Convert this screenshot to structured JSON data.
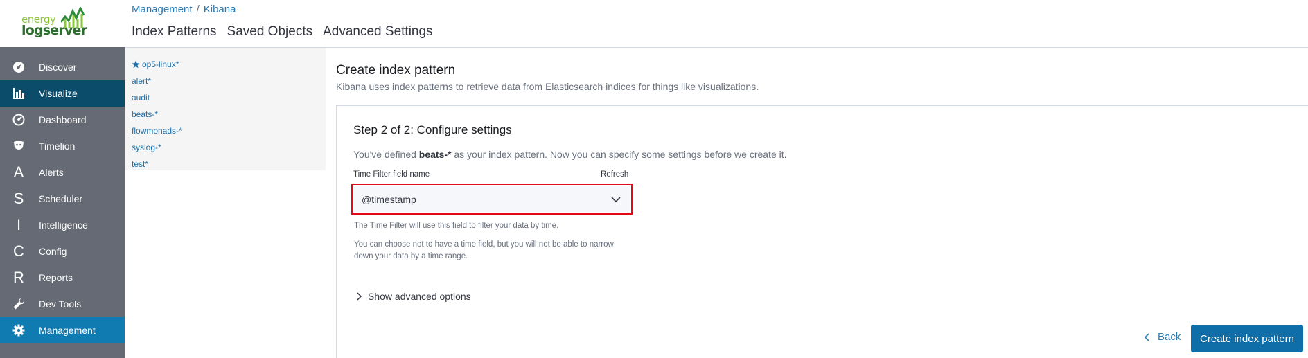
{
  "logo": {
    "line1": "energy",
    "line2": "logserver"
  },
  "sidebar": {
    "items": [
      {
        "label": "Discover",
        "icon": "compass-icon",
        "state": "normal"
      },
      {
        "label": "Visualize",
        "icon": "bar-chart-icon",
        "state": "active"
      },
      {
        "label": "Dashboard",
        "icon": "dashboard-icon",
        "state": "normal"
      },
      {
        "label": "Timelion",
        "icon": "timelion-icon",
        "state": "normal"
      },
      {
        "label": "Alerts",
        "icon": "A",
        "state": "normal"
      },
      {
        "label": "Scheduler",
        "icon": "S",
        "state": "normal"
      },
      {
        "label": "Intelligence",
        "icon": "I",
        "state": "normal"
      },
      {
        "label": "Config",
        "icon": "C",
        "state": "normal"
      },
      {
        "label": "Reports",
        "icon": "R",
        "state": "normal"
      },
      {
        "label": "Dev Tools",
        "icon": "wrench-icon",
        "state": "normal"
      },
      {
        "label": "Management",
        "icon": "gear-icon",
        "state": "selected"
      }
    ]
  },
  "breadcrumb": {
    "root": "Management",
    "sep": "/",
    "current": "Kibana"
  },
  "tabs": [
    "Index Patterns",
    "Saved Objects",
    "Advanced Settings"
  ],
  "pattern_list": [
    {
      "label": "op5-linux*",
      "default": true
    },
    {
      "label": "alert*",
      "default": false
    },
    {
      "label": "audit",
      "default": false
    },
    {
      "label": "beats-*",
      "default": false
    },
    {
      "label": "flowmonads-*",
      "default": false
    },
    {
      "label": "syslog-*",
      "default": false
    },
    {
      "label": "test*",
      "default": false
    }
  ],
  "main": {
    "title": "Create index pattern",
    "subtitle": "Kibana uses index patterns to retrieve data from Elasticsearch indices for things like visualizations.",
    "step_title": "Step 2 of 2: Configure settings",
    "desc_prefix": "You've defined ",
    "desc_pattern": "beats-*",
    "desc_suffix": " as your index pattern. Now you can specify some settings before we create it.",
    "field_label": "Time Filter field name",
    "refresh": "Refresh",
    "time_field_value": "@timestamp",
    "help1": "The Time Filter will use this field to filter your data by time.",
    "help2": "You can choose not to have a time field, but you will not be able to narrow down your data by a time range.",
    "advanced": "Show advanced options",
    "back": "Back",
    "create": "Create index pattern"
  },
  "colors": {
    "sidebar_bg": "#666a74",
    "active_bg": "#0b4c6b",
    "selected_bg": "#0f7bb0",
    "link": "#2b7bb5",
    "primary_button": "#0f6ea8",
    "highlight_border": "#e4081b"
  }
}
